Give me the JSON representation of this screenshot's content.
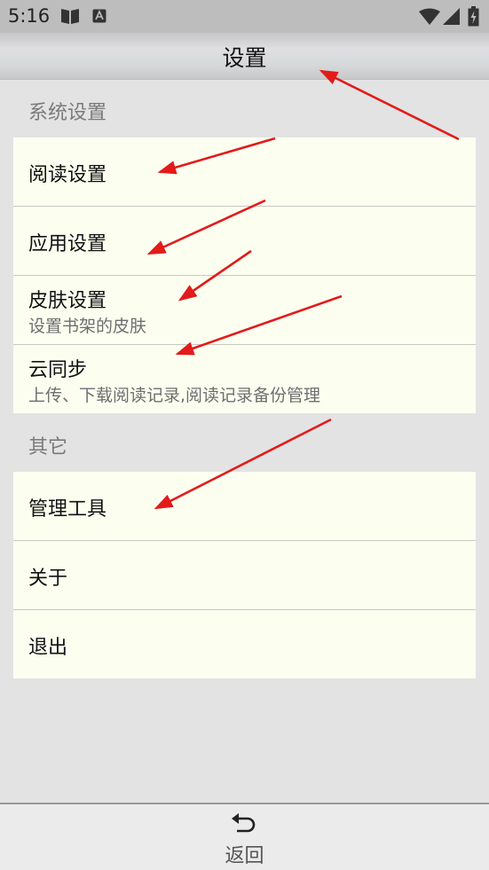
{
  "status_bar": {
    "time": "5:16",
    "icons": [
      "book-icon",
      "keyboard-a-icon",
      "wifi-icon",
      "signal-icon",
      "battery-charging-icon"
    ]
  },
  "header": {
    "title": "设置"
  },
  "sections": [
    {
      "header": "系统设置",
      "items": [
        {
          "title": "阅读设置",
          "subtitle": ""
        },
        {
          "title": "应用设置",
          "subtitle": ""
        },
        {
          "title": "皮肤设置",
          "subtitle": "设置书架的皮肤"
        },
        {
          "title": "云同步",
          "subtitle": "上传、下载阅读记录,阅读记录备份管理"
        }
      ]
    },
    {
      "header": "其它",
      "items": [
        {
          "title": "管理工具",
          "subtitle": ""
        },
        {
          "title": "关于",
          "subtitle": ""
        },
        {
          "title": "退出",
          "subtitle": ""
        }
      ]
    }
  ],
  "footer": {
    "back_label": "返回",
    "back_icon": "return-arrow-icon"
  },
  "colors": {
    "status_bar": "#bdbdbd",
    "background": "#e3e3e3",
    "card": "#fcfff0",
    "annotation_arrow": "#e31a1a"
  }
}
